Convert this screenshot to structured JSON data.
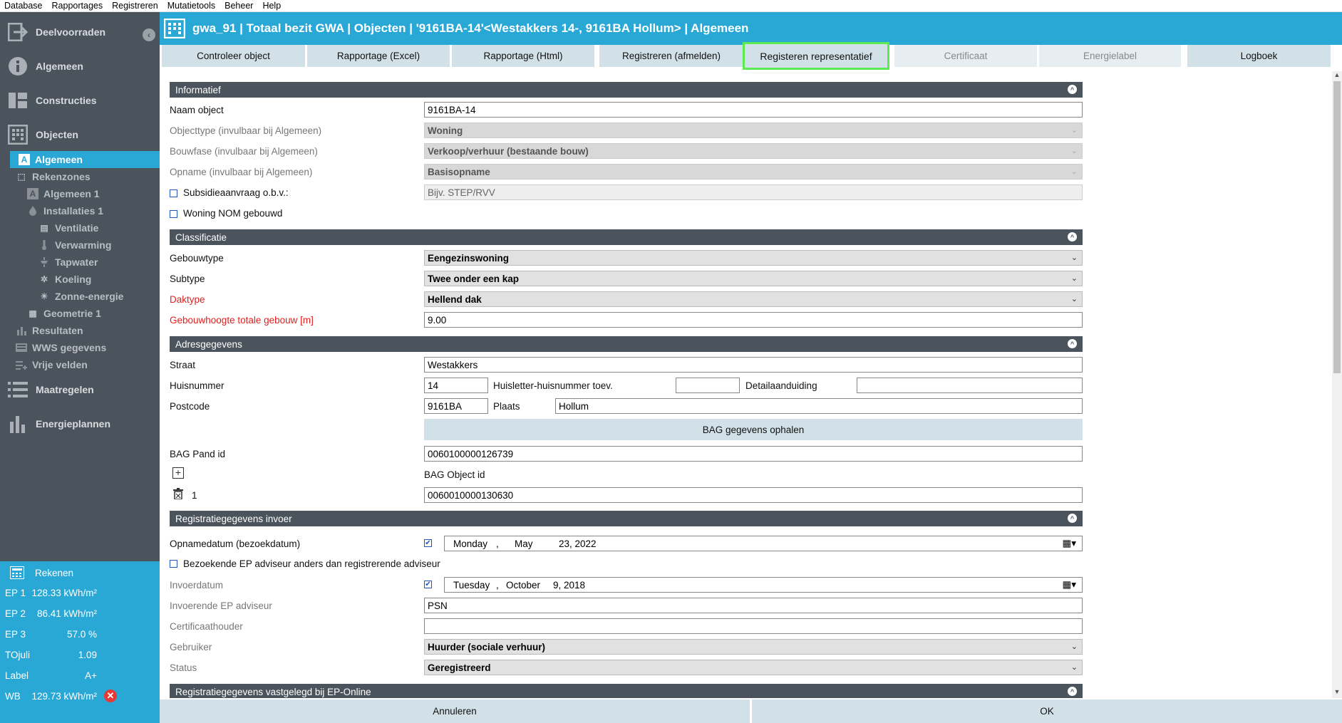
{
  "menu": [
    "Database",
    "Rapportages",
    "Registreren",
    "Mutatietools",
    "Beheer",
    "Help"
  ],
  "sidebar": {
    "main": [
      {
        "label": "Deelvoorraden",
        "icon": "exit-icon"
      },
      {
        "label": "Algemeen",
        "icon": "info-icon"
      },
      {
        "label": "Constructies",
        "icon": "blocks-icon"
      },
      {
        "label": "Objecten",
        "icon": "building-icon"
      }
    ],
    "tree": [
      {
        "label": "Algemeen",
        "icon": "A"
      },
      {
        "label": "Rekenzones",
        "icon": "⬚"
      },
      {
        "label": "Algemeen 1",
        "icon": "A"
      },
      {
        "label": "Installaties 1",
        "icon": "🔥"
      },
      {
        "label": "Ventilatie",
        "icon": "▤"
      },
      {
        "label": "Verwarming",
        "icon": "🌡"
      },
      {
        "label": "Tapwater",
        "icon": "🚿"
      },
      {
        "label": "Koeling",
        "icon": "✲"
      },
      {
        "label": "Zonne-energie",
        "icon": "☀"
      },
      {
        "label": "Geometrie 1",
        "icon": "▦"
      },
      {
        "label": "Resultaten",
        "icon": "▮"
      },
      {
        "label": "WWS gegevens",
        "icon": "▤"
      },
      {
        "label": "Vrije velden",
        "icon": "≡"
      }
    ],
    "lower": [
      {
        "label": "Maatregelen",
        "icon": "list-icon"
      },
      {
        "label": "Energieplannen",
        "icon": "bars-icon"
      }
    ]
  },
  "calc": {
    "title": "Rekenen",
    "rows": [
      {
        "k": "EP 1",
        "v": "128.33 kWh/m²"
      },
      {
        "k": "EP 2",
        "v": "86.41 kWh/m²"
      },
      {
        "k": "EP 3",
        "v": "57.0 %"
      },
      {
        "k": "TOjuli",
        "v": "1.09"
      },
      {
        "k": "Label",
        "v": "A+"
      },
      {
        "k": "WB",
        "v": "129.73 kWh/m²"
      }
    ]
  },
  "title": "gwa_91 | Totaal bezit GWA | Objecten | '9161BA-14'<Westakkers 14-, 9161BA Hollum> | Algemeen",
  "tabs": [
    {
      "label": "Controleer object",
      "state": "normal"
    },
    {
      "label": "Rapportage (Excel)",
      "state": "normal"
    },
    {
      "label": "Rapportage (Html)",
      "state": "normal"
    },
    {
      "label": "Registreren (afmelden)",
      "state": "normal"
    },
    {
      "label": "Registeren representatief",
      "state": "highlight"
    },
    {
      "label": "Certificaat",
      "state": "disabled"
    },
    {
      "label": "Energielabel",
      "state": "disabled"
    },
    {
      "label": "Logboek",
      "state": "normal"
    }
  ],
  "sections": {
    "informatief": "Informatief",
    "classificatie": "Classificatie",
    "adres": "Adresgegevens",
    "registratie": "Registratiegegevens invoer",
    "vastgelegd": "Registratiegegevens vastgelegd bij EP-Online"
  },
  "info": {
    "naam_label": "Naam object",
    "naam_value": "9161BA-14",
    "objecttype_label": "Objecttype (invulbaar bij Algemeen)",
    "objecttype_value": "Woning",
    "bouwfase_label": "Bouwfase (invulbaar bij Algemeen)",
    "bouwfase_value": "Verkoop/verhuur (bestaande bouw)",
    "opname_label": "Opname (invulbaar bij Algemeen)",
    "opname_value": "Basisopname",
    "subsidie_label": "Subsidieaanvraag o.b.v.:",
    "subsidie_placeholder": "Bijv. STEP/RVV",
    "nom_label": "Woning NOM gebouwd"
  },
  "classificatie": {
    "gebouwtype_label": "Gebouwtype",
    "gebouwtype_value": "Eengezinswoning",
    "subtype_label": "Subtype",
    "subtype_value": "Twee onder een kap",
    "daktype_label": "Daktype",
    "daktype_value": "Hellend dak",
    "hoogte_label": "Gebouwhoogte totale gebouw [m]",
    "hoogte_value": "9.00"
  },
  "adres": {
    "straat_label": "Straat",
    "straat_value": "Westakkers",
    "huisnummer_label": "Huisnummer",
    "huisnummer_value": "14",
    "toev_label": "Huisletter-huisnummer toev.",
    "toev_value": "",
    "detail_label": "Detailaanduiding",
    "detail_value": "",
    "postcode_label": "Postcode",
    "postcode_value": "9161BA",
    "plaats_label": "Plaats",
    "plaats_value": "Hollum",
    "bag_button": "BAG gegevens ophalen",
    "pand_label": "BAG Pand id",
    "pand_value": "0060100000126739",
    "object_label": "BAG Object id",
    "object_index": "1",
    "object_value": "0060010000130630"
  },
  "registratie": {
    "opname_label": "Opnamedatum (bezoekdatum)",
    "opname_day": "Monday",
    "opname_month": "May",
    "opname_date": "23, 2022",
    "bezoekende_label": "Bezoekende EP adviseur anders dan registrerende adviseur",
    "invoer_label": "Invoerdatum",
    "invoer_day": "Tuesday",
    "invoer_month": "October",
    "invoer_date": "9, 2018",
    "adviseur_label": "Invoerende  EP adviseur",
    "adviseur_value": "PSN",
    "cert_label": "Certificaathouder",
    "cert_value": "",
    "gebruiker_label": "Gebruiker",
    "gebruiker_value": "Huurder (sociale verhuur)",
    "status_label": "Status",
    "status_value": "Geregistreerd"
  },
  "footer": {
    "cancel": "Annuleren",
    "ok": "OK"
  },
  "colors": {
    "accent": "#29a8d6",
    "sidebar": "#4b535c",
    "button": "#d2e1e8",
    "highlight": "#5bea52",
    "required": "#e02020"
  }
}
